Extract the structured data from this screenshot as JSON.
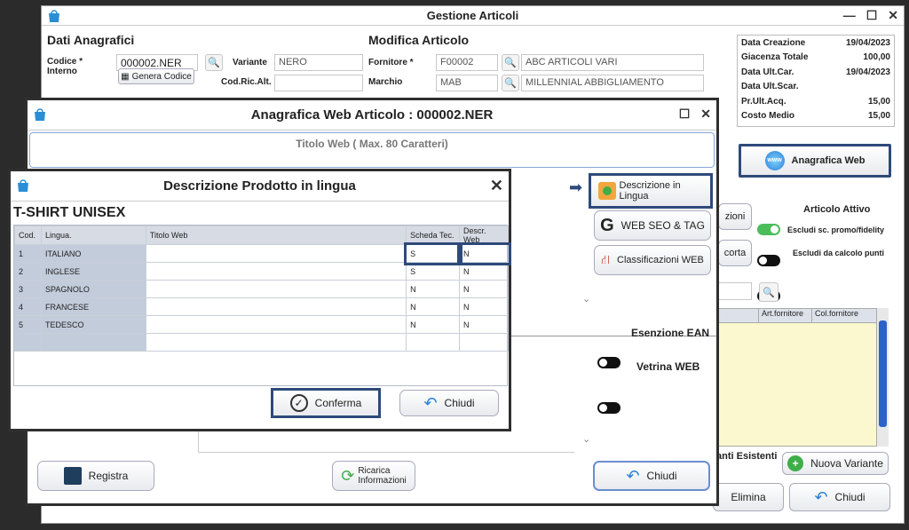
{
  "main": {
    "title": "Gestione Articoli",
    "dati_header": "Dati Anagrafici",
    "modifica_header": "Modifica Articolo",
    "codice_label": "Codice *\nInterno",
    "codice_value": "000002.NER",
    "genera_codice": "Genera Codice",
    "variante_label": "Variante",
    "variante_value": "NERO",
    "codric_label": "Cod.Ric.Alt.",
    "fornitore_label": "Fornitore *",
    "fornitore_code": "F00002",
    "fornitore_name": "ABC ARTICOLI VARI",
    "marchio_label": "Marchio",
    "marchio_code": "MAB",
    "marchio_name": "MILLENNIAL ABBIGLIAMENTO",
    "info": [
      {
        "label": "Data Creazione",
        "value": "19/04/2023"
      },
      {
        "label": "Giacenza Totale",
        "value": "100,00"
      },
      {
        "label": "Data Ult.Car.",
        "value": "19/04/2023"
      },
      {
        "label": "Data Ult.Scar.",
        "value": ""
      },
      {
        "label": "Pr.Ult.Acq.",
        "value": "15,00"
      },
      {
        "label": "Costo Medio",
        "value": "15,00"
      }
    ],
    "anagrafica_web": "Anagrafica Web",
    "articolo_attivo": "Articolo Attivo",
    "escludi_promo": "Escludi sc. promo/fidelity",
    "escludi_punti": "Escludi da calcolo punti",
    "zioni": "zioni",
    "corta": "corta",
    "col_art_fornitore": "Art.fornitore",
    "col_col_fornitore": "Col.fornitore",
    "anti_esistenti": "anti Esistenti",
    "nuova_variante": "Nuova Variante",
    "elimina": "Elimina",
    "chiudi": "Chiudi"
  },
  "web": {
    "title": "Anagrafica Web Articolo : 000002.NER",
    "titolo_web": "Titolo Web ( Max. 80 Caratteri)",
    "descrizione_lingua": "Descrizione in Lingua",
    "web_seo": "WEB SEO & TAG",
    "classificazioni": "Classificazioni WEB",
    "esenzione_ean": "Esenzione EAN",
    "vetrina_web": "Vetrina WEB",
    "registra": "Registra",
    "ricarica": "Ricarica\nInformazioni",
    "chiudi": "Chiudi"
  },
  "desc": {
    "title": "Descrizione Prodotto in lingua",
    "product": "T-SHIRT UNISEX",
    "columns": [
      "Cod.",
      "Lingua.",
      "Titolo Web",
      "Scheda Tec.",
      "Descr. Web"
    ],
    "rows": [
      {
        "cod": "1",
        "lingua": "ITALIANO",
        "titolo": "",
        "scheda": "S",
        "descr": "N"
      },
      {
        "cod": "2",
        "lingua": "INGLESE",
        "titolo": "",
        "scheda": "S",
        "descr": "N"
      },
      {
        "cod": "3",
        "lingua": "SPAGNOLO",
        "titolo": "",
        "scheda": "N",
        "descr": "N"
      },
      {
        "cod": "4",
        "lingua": "FRANCESE",
        "titolo": "",
        "scheda": "N",
        "descr": "N"
      },
      {
        "cod": "5",
        "lingua": "TEDESCO",
        "titolo": "",
        "scheda": "N",
        "descr": "N"
      }
    ],
    "conferma": "Conferma",
    "chiudi": "Chiudi"
  },
  "colors": {
    "accent": "#2e4a7a",
    "toggle_on": "#4bbd5a",
    "grid_yellow": "#fbf8cf"
  }
}
